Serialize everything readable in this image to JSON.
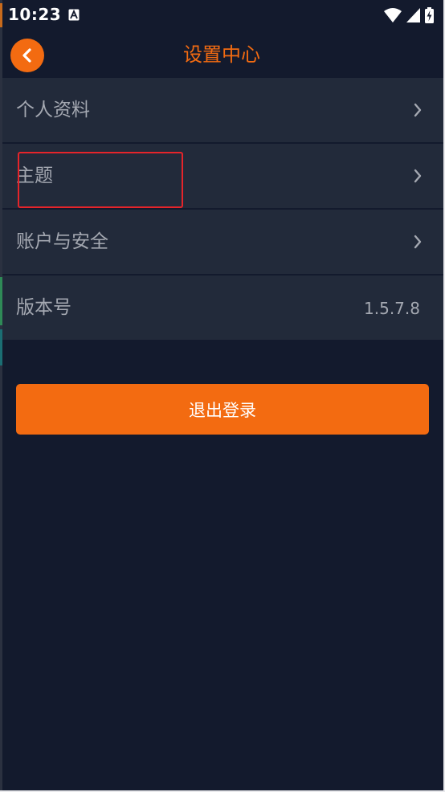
{
  "status_bar": {
    "time": "10:23",
    "icons": [
      "accessibility-a-icon",
      "wifi-icon",
      "signal-icon",
      "battery-charging-icon"
    ]
  },
  "header": {
    "title": "设置中心",
    "back_icon": "chevron-left-icon"
  },
  "settings": {
    "items": [
      {
        "label": "个人资料",
        "trailing": "chevron-right-icon"
      },
      {
        "label": "主题",
        "trailing": "chevron-right-icon",
        "highlighted": true
      },
      {
        "label": "账户与安全",
        "trailing": "chevron-right-icon"
      },
      {
        "label": "版本号",
        "value": "1.5.7.8"
      }
    ]
  },
  "logout": {
    "label": "退出登录"
  },
  "colors": {
    "background": "#131a2d",
    "row_background": "#222a3a",
    "accent": "#f36b11",
    "text_muted": "#a4a8b1",
    "highlight_border": "#e5242a"
  }
}
